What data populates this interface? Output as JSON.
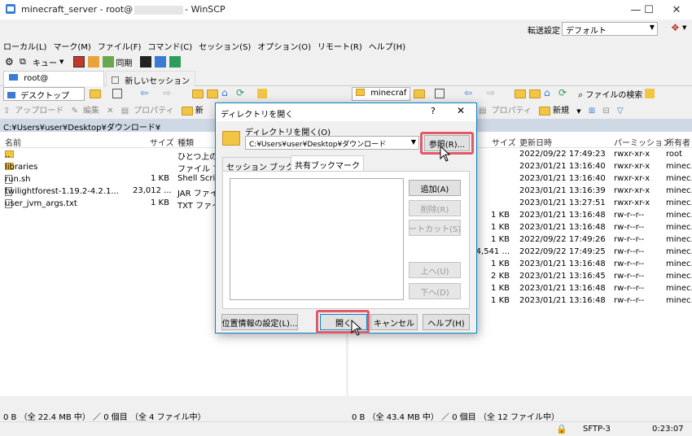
{
  "window": {
    "title_prefix": "minecraft_server - root@",
    "title_suffix": "- WinSCP",
    "minimize": "—",
    "maximize": "☐",
    "close": "✕"
  },
  "transfer": {
    "label": "転送設定",
    "value": "デフォルト"
  },
  "menu": [
    "ローカル(L)",
    "マーク(M)",
    "ファイル(F)",
    "コマンド(C)",
    "セッション(S)",
    "オプション(O)",
    "リモート(R)",
    "ヘルプ(H)"
  ],
  "toolbar": {
    "queue_label": "キュー",
    "sync_label": "同期"
  },
  "tabs": {
    "session": "root@",
    "new_session": "新しいセッション"
  },
  "left": {
    "address": "デスクトップ",
    "commands": {
      "upload": "アップロード",
      "edit": "編集",
      "properties": "プロパティ",
      "new": "新"
    },
    "path": "C:¥Users¥user¥Desktop¥ダウンロード¥",
    "columns": {
      "name": "名前",
      "size": "サイズ",
      "type": "種類"
    },
    "rows": [
      {
        "name": "..",
        "size": "",
        "type": "ひとつ上のデ"
      },
      {
        "name": "libraries",
        "size": "",
        "type": "ファイル フォ"
      },
      {
        "name": "run.sh",
        "size": "1 KB",
        "type": "Shell Scrip"
      },
      {
        "name": "twilightforest-1.19.2-4.2.1...",
        "size": "23,012 ...",
        "type": "JAR ファイル"
      },
      {
        "name": "user_jvm_args.txt",
        "size": "1 KB",
        "type": "TXT ファイル"
      }
    ],
    "status": "0 B （全 22.4 MB 中） ／ 0 個目 （全 4 ファイル中）"
  },
  "right": {
    "address": "minecraf",
    "find_files": "ファイルの検索",
    "commands": {
      "properties": "プロパティ",
      "new": "新規"
    },
    "columns": {
      "size": "サイズ",
      "modified": "更新日時",
      "permissions": "パーミッション",
      "owner": "所有者"
    },
    "rows": [
      {
        "size": "",
        "modified": "2022/09/22 17:49:23",
        "perm": "rwxr-xr-x",
        "owner": "root"
      },
      {
        "size": "",
        "modified": "2023/01/21 13:16:40",
        "perm": "rwxr-xr-x",
        "owner": "minec."
      },
      {
        "size": "",
        "modified": "2023/01/21 13:16:40",
        "perm": "rwxr-xr-x",
        "owner": "minec."
      },
      {
        "size": "",
        "modified": "2023/01/21 13:16:39",
        "perm": "rwxr-xr-x",
        "owner": "minec."
      },
      {
        "size": "",
        "modified": "2023/01/21 13:27:51",
        "perm": "rwxr-xr-x",
        "owner": "minec."
      },
      {
        "size": "1 KB",
        "modified": "2023/01/21 13:16:48",
        "perm": "rw-r--r--",
        "owner": "minec."
      },
      {
        "size": "1 KB",
        "modified": "2023/01/21 13:16:48",
        "perm": "rw-r--r--",
        "owner": "minec."
      },
      {
        "size": "1 KB",
        "modified": "2022/09/22 17:49:26",
        "perm": "rw-r--r--",
        "owner": "minec."
      },
      {
        "size": "4,541 ...",
        "modified": "2022/09/22 17:49:25",
        "perm": "rw-r--r--",
        "owner": "minec."
      },
      {
        "size": "1 KB",
        "modified": "2023/01/21 13:16:48",
        "perm": "rw-r--r--",
        "owner": "minec."
      },
      {
        "size": "2 KB",
        "modified": "2023/01/21 13:16:45",
        "perm": "rw-r--r--",
        "owner": "minec."
      },
      {
        "size": "1 KB",
        "modified": "2023/01/21 13:16:48",
        "perm": "rw-r--r--",
        "owner": "minec."
      },
      {
        "size": "1 KB",
        "modified": "2023/01/21 13:16:48",
        "perm": "rw-r--r--",
        "owner": "minec."
      }
    ],
    "status": "0 B （全 43.4 MB 中） ／ 0 個目 （全 12 ファイル中）"
  },
  "statusbar": {
    "protocol": "SFTP-3",
    "time": "0:23:07"
  },
  "dialog": {
    "title": "ディレクトリを開く",
    "help_q": "?",
    "close": "✕",
    "open_label": "ディレクトリを開く(O)",
    "path_value": "C:¥Users¥user¥Desktop¥ダウンロード",
    "browse": "参照(R)...",
    "tab_session": "セッション ブックマーク",
    "tab_shared": "共有ブックマーク",
    "add": "追加(A)",
    "remove": "削除(R)",
    "shortcut": "ョートカット(S)...",
    "up": "上へ(U)",
    "down": "下へ(D)",
    "location": "位置情報の設定(L)...",
    "open": "開く",
    "cancel": "キャンセル",
    "help": "ヘルプ(H)"
  },
  "colors": {
    "accent": "#0a84c6",
    "highlight": "#e05a6a",
    "pathbar": "#cfd9e6"
  }
}
